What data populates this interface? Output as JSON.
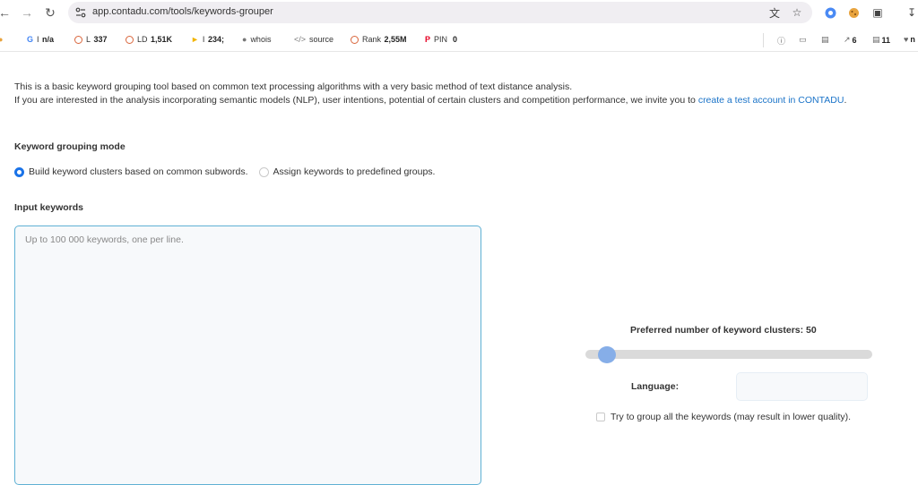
{
  "browser": {
    "url": "app.contadu.com/tools/keywords-grouper"
  },
  "seo_toolbar": {
    "google": {
      "label": "I",
      "value": "n/a"
    },
    "l": {
      "label": "L",
      "value": "337"
    },
    "ld": {
      "label": "LD",
      "value": "1,51K"
    },
    "bing": {
      "label": "I",
      "value": "234;"
    },
    "whois": "whois",
    "source": "source",
    "rank": {
      "label": "Rank",
      "value": "2,55M"
    },
    "pin": {
      "label": "PIN",
      "value": "0"
    },
    "right_a": "6",
    "right_b": "11",
    "right_c": "n"
  },
  "intro": {
    "line1": "This is a basic keyword grouping tool based on common text processing algorithms with a very basic method of text distance analysis.",
    "line2_prefix": "If you are interested in the analysis incorporating semantic models (NLP), user intentions, potential of certain clusters and competition performance, we invite you to ",
    "line2_link": "create a test account in CONTADU",
    "line2_suffix": "."
  },
  "mode": {
    "title": "Keyword grouping mode",
    "option1": "Build keyword clusters based on common subwords.",
    "option2": "Assign keywords to predefined groups.",
    "selected": "option1"
  },
  "input": {
    "title": "Input keywords",
    "placeholder": "Up to 100 000 keywords, one per line.",
    "value": ""
  },
  "settings": {
    "clusters_label": "Preferred number of keyword clusters: 50",
    "clusters_value": 50,
    "clusters_fraction": 0.075,
    "language_label": "Language:",
    "language_value": "",
    "try_all_label": "Try to group all the keywords (may result in lower quality).",
    "try_all_checked": false
  },
  "colors": {
    "link": "#1a73c8",
    "radio_active": "#1a73e8",
    "slider_thumb": "#86aee8",
    "textarea_border": "#5fb1d4"
  }
}
